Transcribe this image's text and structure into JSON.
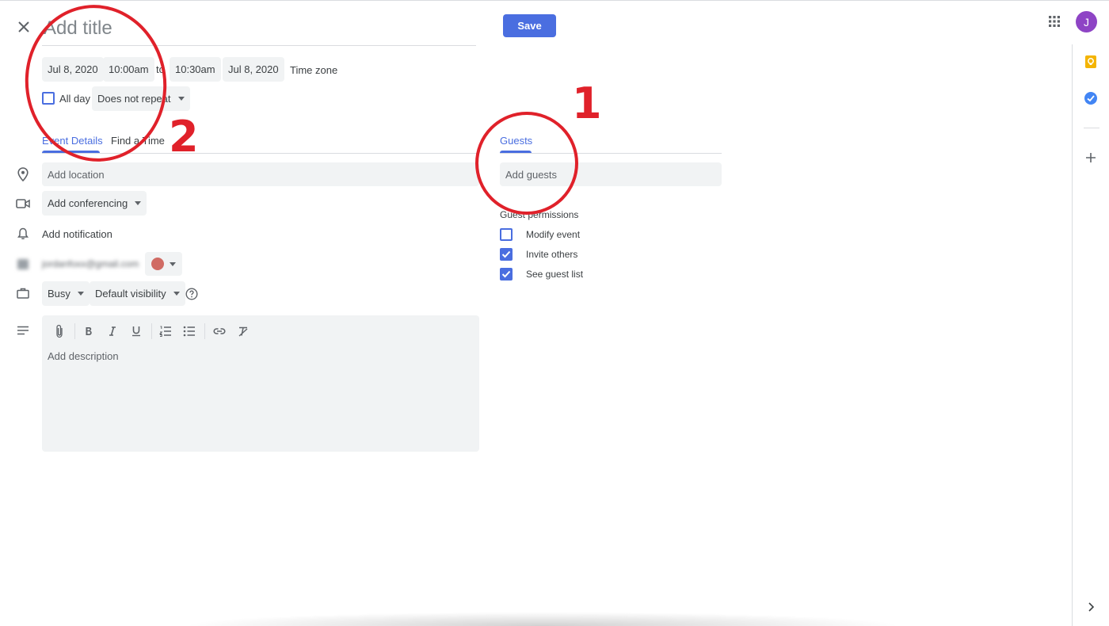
{
  "header": {
    "title_placeholder": "Add title",
    "save_label": "Save",
    "avatar_initial": "J"
  },
  "datetime": {
    "start_date": "Jul 8, 2020",
    "start_time": "10:00am",
    "to_label": "to",
    "end_time": "10:30am",
    "end_date": "Jul 8, 2020",
    "timezone_label": "Time zone",
    "all_day_label": "All day",
    "repeat_label": "Does not repeat"
  },
  "tabs": {
    "event_details": "Event Details",
    "find_time": "Find a Time",
    "guests": "Guests"
  },
  "details": {
    "location_placeholder": "Add location",
    "conferencing_label": "Add conferencing",
    "notification_label": "Add notification",
    "calendar_account": "jordanfoxx@gmail.com",
    "busy_label": "Busy",
    "visibility_label": "Default visibility",
    "description_placeholder": "Add description"
  },
  "guests": {
    "add_placeholder": "Add guests",
    "permissions_heading": "Guest permissions",
    "permissions": [
      {
        "label": "Modify event",
        "checked": false
      },
      {
        "label": "Invite others",
        "checked": true
      },
      {
        "label": "See guest list",
        "checked": true
      }
    ]
  },
  "annotations": {
    "num_1": "1",
    "num_2": "2"
  },
  "colors": {
    "accent": "#4a6ee0",
    "annotation_red": "#e0212a",
    "calendar_color": "#d06b64"
  }
}
